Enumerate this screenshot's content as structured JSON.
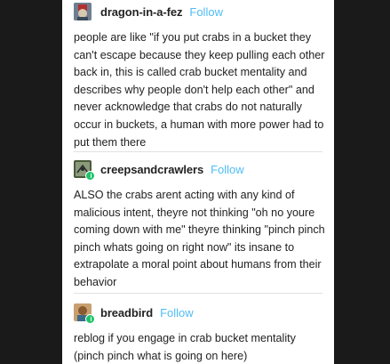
{
  "posts": [
    {
      "username": "dragon-in-a-fez",
      "follow_label": "Follow",
      "avatar_icon": "fez-avatar-icon",
      "text": "people are like \"if you put crabs in a bucket they can't escape because they keep pulling each other back in, this is called crab bucket mentality and describes why people don't help each other\" and never acknowledge that crabs do not naturally occur in buckets, a human with more power had to put them there"
    },
    {
      "username": "creepsandcrawlers",
      "follow_label": "Follow",
      "avatar_icon": "insect-avatar-icon",
      "text": "ALSO the crabs arent acting with any kind of malicious intent, theyre not thinking \"oh no youre coming down with me\" theyre thinking \"pinch pinch pinch whats going on right now\" its insane to extrapolate a moral point about humans from their behavior"
    },
    {
      "username": "breadbird",
      "follow_label": "Follow",
      "avatar_icon": "bird-avatar-icon",
      "text": "reblog if you engage in crab bucket mentality (pinch pinch what is going on here)"
    }
  ],
  "colors": {
    "follow": "#4fbcf5",
    "badge": "#1fc36b",
    "text": "#222222",
    "background": "#ffffff"
  }
}
